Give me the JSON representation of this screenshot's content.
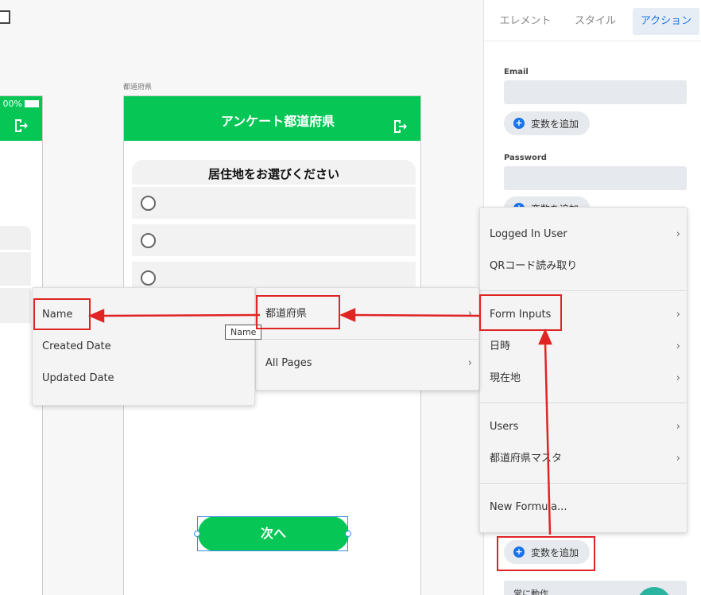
{
  "canvas": {
    "screen_label": "都道府県",
    "left_phone": {
      "status_text": "00%"
    },
    "main_phone": {
      "header_title": "アンケート都道府県",
      "question": "居住地をお選びください",
      "next_button": "次へ"
    }
  },
  "panel": {
    "tabs": [
      {
        "label": "エレメント"
      },
      {
        "label": "スタイル"
      },
      {
        "label": "アクション"
      }
    ],
    "active_tab": "アクション",
    "email_label": "Email",
    "password_label": "Password",
    "add_variable": "変数を追加",
    "bottom_select": "常に動作"
  },
  "menus": {
    "main": {
      "items": [
        {
          "label": "Logged In User",
          "submenu": true
        },
        {
          "label": "QRコード読み取り",
          "submenu": false
        },
        {
          "label": "Form Inputs",
          "submenu": true
        },
        {
          "label": "日時",
          "submenu": true
        },
        {
          "label": "現在地",
          "submenu": true
        },
        {
          "label": "Users",
          "submenu": true
        },
        {
          "label": "都道府県マスタ",
          "submenu": true
        },
        {
          "label": "New Formula...",
          "submenu": false
        }
      ]
    },
    "form_inputs": {
      "items": [
        {
          "label": "都道府県",
          "submenu": false
        },
        {
          "label": "All Pages",
          "submenu": true
        }
      ]
    },
    "prefecture": {
      "items": [
        {
          "label": "Name"
        },
        {
          "label": "Created Date"
        },
        {
          "label": "Updated Date"
        }
      ]
    }
  },
  "tooltip": "Name",
  "colors": {
    "brand_green": "#06c755",
    "annotation_red": "#e02424",
    "accent_blue": "#1a73e8"
  }
}
